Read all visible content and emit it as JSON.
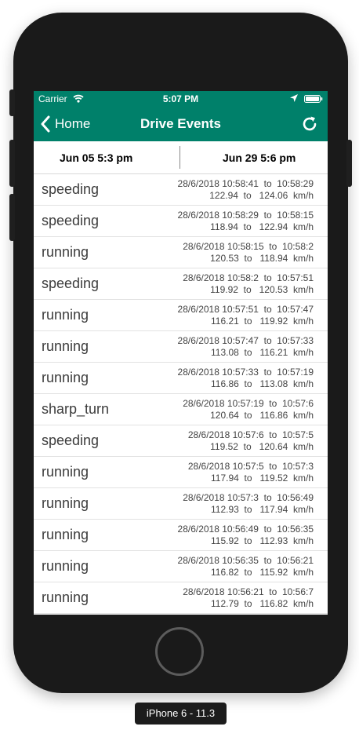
{
  "status": {
    "carrier": "Carrier",
    "time": "5:07 PM"
  },
  "nav": {
    "back_label": "Home",
    "title": "Drive Events"
  },
  "dates": {
    "start": "Jun 05 5:3 pm",
    "end": "Jun 29  5:6 pm"
  },
  "events": [
    {
      "type": "speeding",
      "time": "28/6/2018 10:58:41  to  10:58:29",
      "speed": "122.94  to   124.06  km/h"
    },
    {
      "type": "speeding",
      "time": "28/6/2018 10:58:29  to  10:58:15",
      "speed": "118.94  to   122.94  km/h"
    },
    {
      "type": "running",
      "time": "28/6/2018 10:58:15  to  10:58:2",
      "speed": "120.53  to   118.94  km/h"
    },
    {
      "type": "speeding",
      "time": "28/6/2018 10:58:2  to  10:57:51",
      "speed": "119.92  to   120.53  km/h"
    },
    {
      "type": "running",
      "time": "28/6/2018 10:57:51  to  10:57:47",
      "speed": "116.21  to   119.92  km/h"
    },
    {
      "type": "running",
      "time": "28/6/2018 10:57:47  to  10:57:33",
      "speed": "113.08  to   116.21  km/h"
    },
    {
      "type": "running",
      "time": "28/6/2018 10:57:33  to  10:57:19",
      "speed": "116.86  to   113.08  km/h"
    },
    {
      "type": "sharp_turn",
      "time": "28/6/2018 10:57:19  to  10:57:6",
      "speed": "120.64  to   116.86  km/h"
    },
    {
      "type": "speeding",
      "time": "28/6/2018 10:57:6  to  10:57:5",
      "speed": "119.52  to   120.64  km/h"
    },
    {
      "type": "running",
      "time": "28/6/2018 10:57:5  to  10:57:3",
      "speed": "117.94  to   119.52  km/h"
    },
    {
      "type": "running",
      "time": "28/6/2018 10:57:3  to  10:56:49",
      "speed": "112.93  to   117.94  km/h"
    },
    {
      "type": "running",
      "time": "28/6/2018 10:56:49  to  10:56:35",
      "speed": "115.92  to   112.93  km/h"
    },
    {
      "type": "running",
      "time": "28/6/2018 10:56:35  to  10:56:21",
      "speed": "116.82  to   115.92  km/h"
    },
    {
      "type": "running",
      "time": "28/6/2018 10:56:21  to  10:56:7",
      "speed": "112.79  to   116.82  km/h"
    }
  ],
  "device_label": "iPhone 6 - 11.3",
  "colors": {
    "accent": "#00806a"
  },
  "icons": {
    "back": "chevron-left-icon",
    "refresh": "refresh-icon",
    "wifi": "wifi-icon",
    "location": "location-arrow-icon",
    "battery": "battery-icon"
  }
}
